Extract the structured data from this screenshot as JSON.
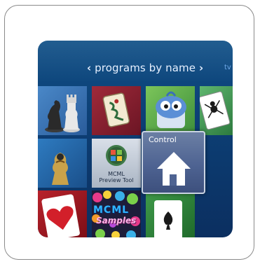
{
  "navigation": {
    "prev_arrow": "‹",
    "title": "programs by name",
    "next_arrow": "›",
    "next_section": "tv +"
  },
  "tiles": {
    "preview_tool": {
      "line1": "MCML",
      "line2": "Preview Tool"
    },
    "samples": {
      "line1": "MCML",
      "line2": "Samples"
    }
  },
  "remote_control": {
    "title_faded": "",
    "title_bright": "Control"
  }
}
